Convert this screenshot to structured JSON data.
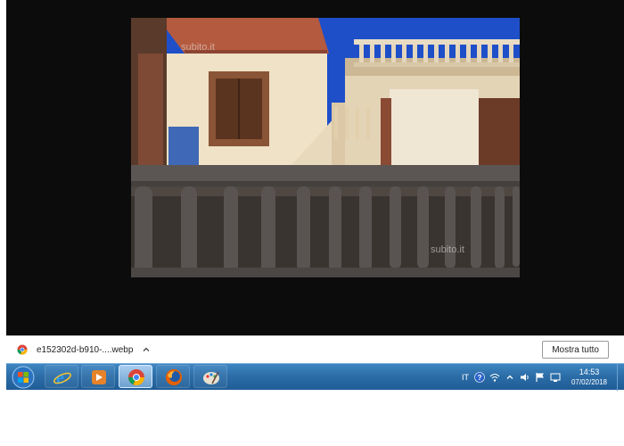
{
  "image": {
    "watermark_top": "subito.it",
    "watermark_bottom": "subito.it"
  },
  "download_bar": {
    "file_name": "e152302d-b910-....webp",
    "file_icon": "chrome-icon",
    "menu_icon": "chevron-up-icon",
    "show_all_label": "Mostra tutto"
  },
  "taskbar": {
    "start_icon": "windows-start-icon",
    "pinned": [
      {
        "name": "internet-explorer-icon",
        "active": false
      },
      {
        "name": "media-player-icon",
        "active": false
      },
      {
        "name": "chrome-icon",
        "active": true
      },
      {
        "name": "firefox-icon",
        "active": false
      },
      {
        "name": "paint-icon",
        "active": false
      }
    ],
    "tray": {
      "language": "IT",
      "icons": [
        "help-icon",
        "network-icon",
        "chevron-up-icon",
        "volume-icon",
        "flag-icon",
        "monitor-icon"
      ],
      "time": "14:53",
      "date": "07/02/2018"
    }
  },
  "colors": {
    "viewer_bg": "#0c0c0c",
    "taskbar": "#2c6ea8",
    "sky": "#1e4fc9"
  }
}
